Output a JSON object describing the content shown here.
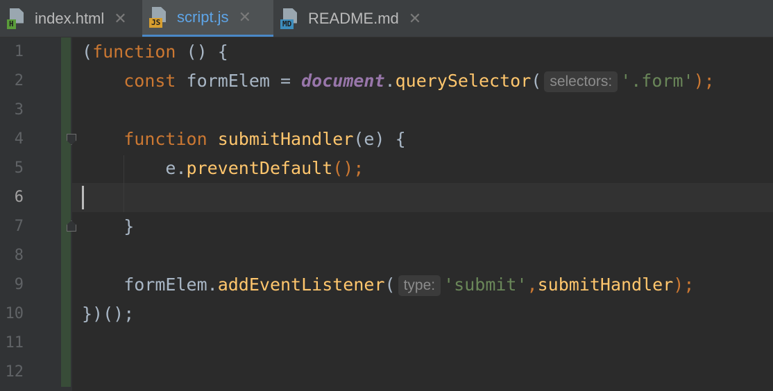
{
  "tabs": [
    {
      "label": "index.html",
      "badge": "H",
      "badge_color": "#5a9c3a",
      "active": false
    },
    {
      "label": "script.js",
      "badge": "JS",
      "badge_color": "#d79e2f",
      "active": true
    },
    {
      "label": "README.md",
      "badge": "MD",
      "badge_color": "#3d8dbd",
      "active": false
    }
  ],
  "close_glyph": "✕",
  "line_numbers": [
    "1",
    "2",
    "3",
    "4",
    "5",
    "6",
    "7",
    "8",
    "9",
    "10",
    "11",
    "12"
  ],
  "current_line": "6",
  "code": {
    "l1": {
      "paren": "(",
      "kw": "function",
      "rest": " () {"
    },
    "l2": {
      "kw": "const",
      "var": " formElem = ",
      "glob": "document",
      "dot": ".",
      "fn": "querySelector",
      "open": "(",
      "hint": "selectors:",
      "str": "'.form'",
      "close": ");"
    },
    "l4": {
      "kw": "function",
      "sp": " ",
      "fn": "submitHandler",
      "rest": "(e) {"
    },
    "l5": {
      "obj": "e.",
      "fn": "preventDefault",
      "rest": "();"
    },
    "l7": {
      "rest": "}"
    },
    "l9": {
      "obj": "formElem.",
      "fn": "addEventListener",
      "open": "(",
      "hint": "type:",
      "str": "'submit'",
      "comma": ",",
      "arg": "submitHandler",
      "close": ");"
    },
    "l10": {
      "rest": "})();"
    }
  },
  "colors": {
    "keyword": "#cc7832",
    "function": "#ffc66d",
    "string": "#6a8759",
    "global": "#9876aa",
    "plain": "#a9b7c6",
    "accent": "#4a88c7"
  }
}
